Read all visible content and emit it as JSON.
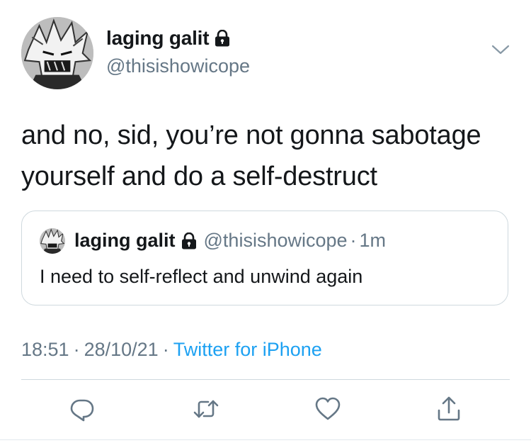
{
  "tweet": {
    "author": {
      "display_name": "laging galit",
      "handle": "@thisishowicope",
      "avatar_icon": "manga-avatar",
      "lock_icon": "lock-icon"
    },
    "menu_icon": "chevron-down-icon",
    "text_lines": [
      "and no, sid, you’re not gonna sabotage",
      "yourself and do a self-destruct"
    ],
    "quoted": {
      "display_name": "laging galit",
      "handle": "@thisishowicope",
      "dot": "·",
      "time": "1m",
      "text": "I need to self-reflect and unwind again"
    },
    "meta": {
      "time": "18:51",
      "separator": "·",
      "date": "28/10/21",
      "source": "Twitter for iPhone"
    },
    "actions": {
      "reply_icon": "reply-icon",
      "retweet_icon": "retweet-icon",
      "like_icon": "heart-icon",
      "share_icon": "share-icon"
    },
    "colors": {
      "text": "#14171a",
      "secondary": "#657786",
      "accent": "#1da1f2",
      "border": "#cfd9de"
    }
  }
}
